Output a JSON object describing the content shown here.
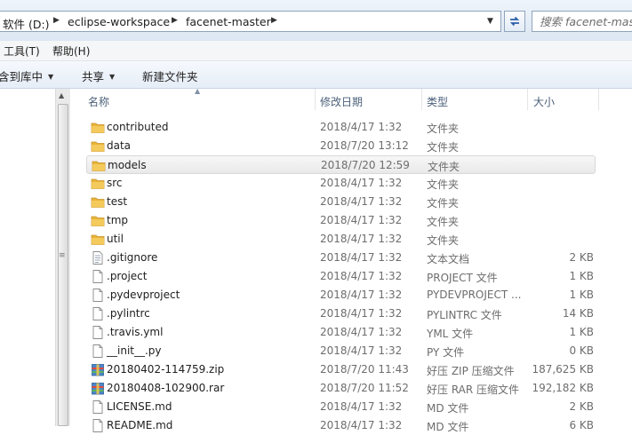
{
  "address": {
    "crumbs": [
      "软件 (D:)",
      "eclipse-workspace",
      "facenet-master"
    ],
    "search_placeholder": "搜索 facenet-master"
  },
  "menu": {
    "items": [
      "工具(T)",
      "帮助(H)"
    ]
  },
  "toolbar": {
    "include_label": "含到库中",
    "share_label": "共享",
    "new_folder_label": "新建文件夹"
  },
  "columns": {
    "name": "名称",
    "date": "修改日期",
    "type": "类型",
    "size": "大小"
  },
  "files": [
    {
      "name": "contributed",
      "date": "2018/4/17 1:32",
      "type": "文件夹",
      "size": "",
      "icon": "folder-icon"
    },
    {
      "name": "data",
      "date": "2018/7/20 13:12",
      "type": "文件夹",
      "size": "",
      "icon": "folder-icon"
    },
    {
      "name": "models",
      "date": "2018/7/20 12:59",
      "type": "文件夹",
      "size": "",
      "icon": "folder-icon"
    },
    {
      "name": "src",
      "date": "2018/4/17 1:32",
      "type": "文件夹",
      "size": "",
      "icon": "folder-icon"
    },
    {
      "name": "test",
      "date": "2018/4/17 1:32",
      "type": "文件夹",
      "size": "",
      "icon": "folder-icon"
    },
    {
      "name": "tmp",
      "date": "2018/4/17 1:32",
      "type": "文件夹",
      "size": "",
      "icon": "folder-icon"
    },
    {
      "name": "util",
      "date": "2018/4/17 1:32",
      "type": "文件夹",
      "size": "",
      "icon": "folder-icon"
    },
    {
      "name": ".gitignore",
      "date": "2018/4/17 1:32",
      "type": "文本文档",
      "size": "2 KB",
      "icon": "text-file-icon"
    },
    {
      "name": ".project",
      "date": "2018/4/17 1:32",
      "type": "PROJECT 文件",
      "size": "1 KB",
      "icon": "file-icon"
    },
    {
      "name": ".pydevproject",
      "date": "2018/4/17 1:32",
      "type": "PYDEVPROJECT ...",
      "size": "1 KB",
      "icon": "file-icon"
    },
    {
      "name": ".pylintrc",
      "date": "2018/4/17 1:32",
      "type": "PYLINTRC 文件",
      "size": "14 KB",
      "icon": "file-icon"
    },
    {
      "name": ".travis.yml",
      "date": "2018/4/17 1:32",
      "type": "YML 文件",
      "size": "1 KB",
      "icon": "file-icon"
    },
    {
      "name": "__init__.py",
      "date": "2018/4/17 1:32",
      "type": "PY 文件",
      "size": "0 KB",
      "icon": "file-icon"
    },
    {
      "name": "20180402-114759.zip",
      "date": "2018/7/20 11:43",
      "type": "好压 ZIP 压缩文件",
      "size": "187,625 KB",
      "icon": "archive-icon"
    },
    {
      "name": "20180408-102900.rar",
      "date": "2018/7/20 11:52",
      "type": "好压 RAR 压缩文件",
      "size": "192,182 KB",
      "icon": "archive-icon"
    },
    {
      "name": "LICENSE.md",
      "date": "2018/4/17 1:32",
      "type": "MD 文件",
      "size": "2 KB",
      "icon": "file-icon"
    },
    {
      "name": "README.md",
      "date": "2018/4/17 1:32",
      "type": "MD 文件",
      "size": "6 KB",
      "icon": "file-icon"
    }
  ],
  "selected_index": 2,
  "colors": {
    "folder": "#e8b43a",
    "header_text": "#4c607a",
    "meta_text": "#6d6d6d"
  }
}
